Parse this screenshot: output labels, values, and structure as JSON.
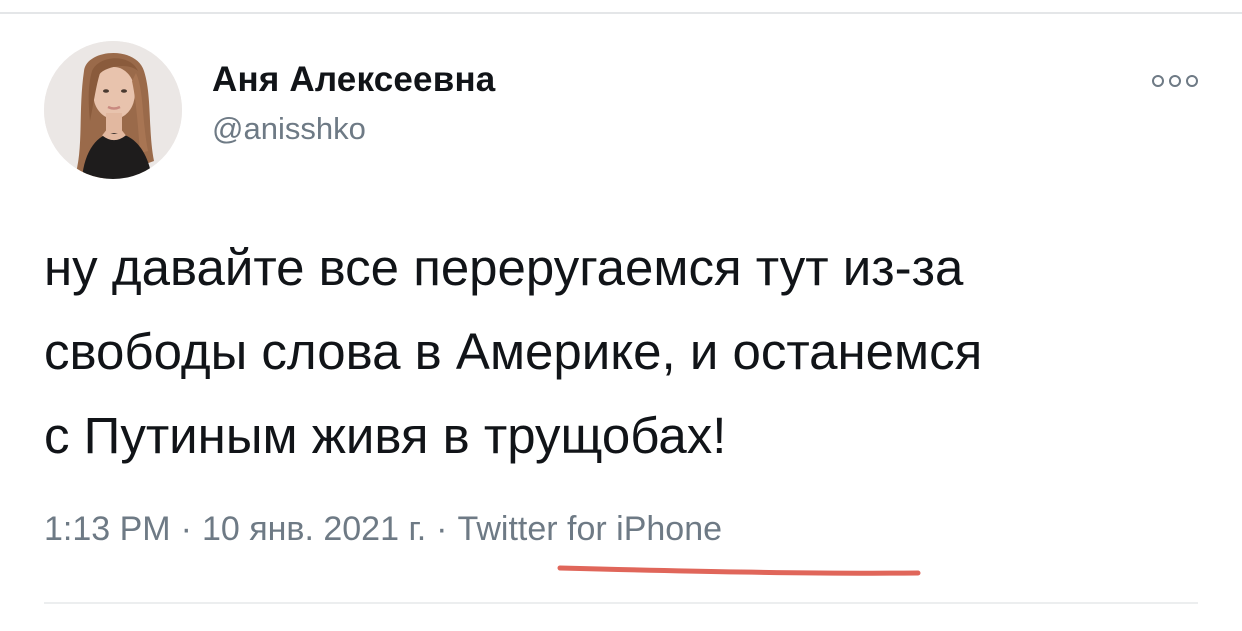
{
  "tweet": {
    "author": {
      "display_name": "Аня Алексеевна",
      "handle": "@anisshko"
    },
    "more_icon": "more-options-icon",
    "text_lines": [
      "ну давайте все переругаемся тут из-за",
      "свободы слова в Америке, и останемся",
      "с Путиным живя в трущобах!"
    ],
    "meta": {
      "time": "1:13 PM",
      "separator": "·",
      "date": "10 янв. 2021 г.",
      "source": "Twitter for iPhone"
    }
  },
  "colors": {
    "text": "#111418",
    "secondary": "#6e7a85",
    "annotation_underline": "#e0665a",
    "divider": "#e4e6e8"
  }
}
